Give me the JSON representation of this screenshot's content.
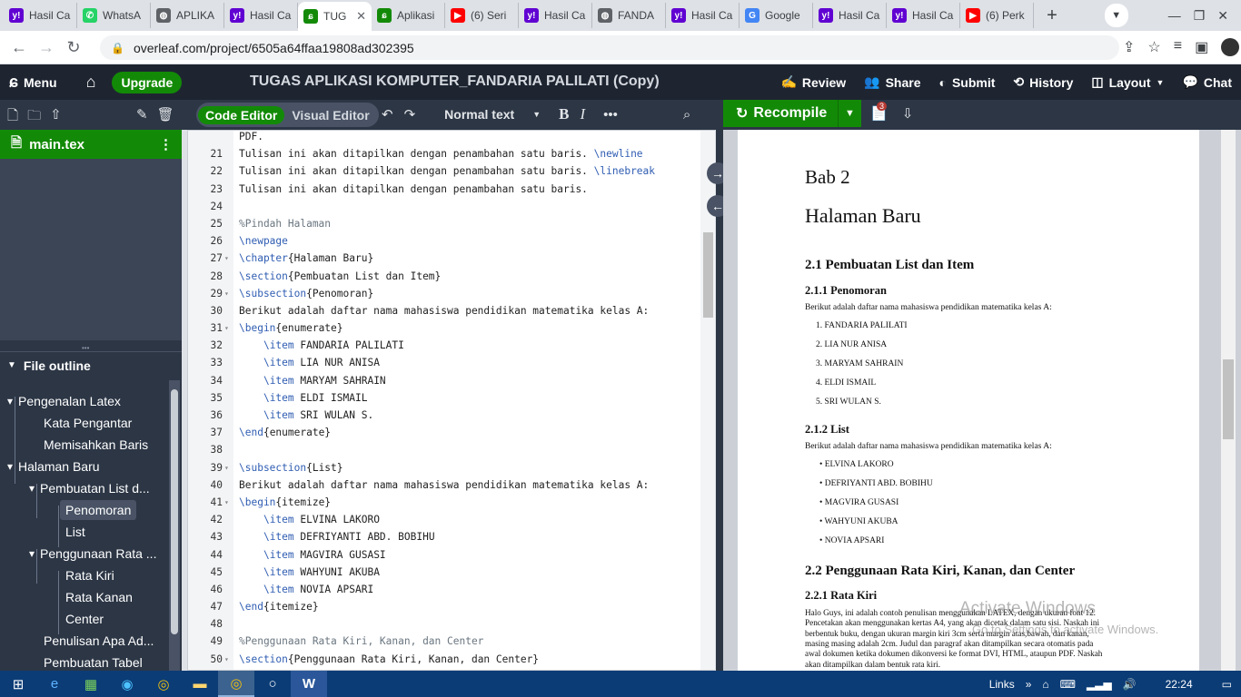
{
  "browser": {
    "tabs": [
      {
        "label": "Hasil Ca",
        "icon": "yahoo-icon",
        "color": "#6001d2"
      },
      {
        "label": "WhatsA",
        "icon": "whatsapp-icon",
        "color": "#25d366"
      },
      {
        "label": "APLIKA",
        "icon": "globe-icon",
        "color": "#5f6368"
      },
      {
        "label": "Hasil Ca",
        "icon": "yahoo-icon",
        "color": "#6001d2"
      },
      {
        "label": "TUG",
        "icon": "overleaf-icon",
        "color": "#138a07",
        "active": true
      },
      {
        "label": "Aplikasi",
        "icon": "overleaf-icon",
        "color": "#138a07"
      },
      {
        "label": "(6) Seri",
        "icon": "youtube-icon",
        "color": "#ff0000"
      },
      {
        "label": "Hasil Ca",
        "icon": "yahoo-icon",
        "color": "#6001d2"
      },
      {
        "label": "FANDA",
        "icon": "globe-icon",
        "color": "#5f6368"
      },
      {
        "label": "Hasil Ca",
        "icon": "yahoo-icon",
        "color": "#6001d2"
      },
      {
        "label": "Google",
        "icon": "google-translate-icon",
        "color": "#4285f4"
      },
      {
        "label": "Hasil Ca",
        "icon": "yahoo-icon",
        "color": "#6001d2"
      },
      {
        "label": "Hasil Ca",
        "icon": "yahoo-icon",
        "color": "#6001d2"
      },
      {
        "label": "(6) Perk",
        "icon": "youtube-icon",
        "color": "#ff0000"
      }
    ],
    "url": "overleaf.com/project/6505a64ffaa19808ad302395"
  },
  "topbar": {
    "menu": "Menu",
    "upgrade": "Upgrade",
    "title": "TUGAS APLIKASI KOMPUTER_FANDARIA PALILATI (Copy)",
    "review": "Review",
    "share": "Share",
    "submit": "Submit",
    "history": "History",
    "layout": "Layout",
    "chat": "Chat"
  },
  "toolbar": {
    "code_editor": "Code Editor",
    "visual_editor": "Visual Editor",
    "style": "Normal text",
    "recompile": "Recompile",
    "logs_badge": "3"
  },
  "sidebar": {
    "file": "main.tex",
    "outline_title": "File outline",
    "outline": [
      {
        "label": "Pengenalan Latex"
      },
      {
        "label": "Kata Pengantar"
      },
      {
        "label": "Memisahkan Baris"
      },
      {
        "label": "Halaman Baru"
      },
      {
        "label": "Pembuatan List d..."
      },
      {
        "label": "Penomoran"
      },
      {
        "label": "List"
      },
      {
        "label": "Penggunaan Rata ..."
      },
      {
        "label": "Rata Kiri"
      },
      {
        "label": "Rata Kanan"
      },
      {
        "label": "Center"
      },
      {
        "label": "Penulisan Apa Ad..."
      },
      {
        "label": "Pembuatan Tabel"
      }
    ]
  },
  "editor": {
    "lines": [
      {
        "n": "",
        "t": "PDF."
      },
      {
        "n": "21",
        "t": "Tulisan ini akan ditapilkan dengan penambahan satu baris. \\newline"
      },
      {
        "n": "22",
        "t": "Tulisan ini akan ditapilkan dengan penambahan satu baris. \\linebreak"
      },
      {
        "n": "23",
        "t": "Tulisan ini akan ditapilkan dengan penambahan satu baris."
      },
      {
        "n": "24",
        "t": ""
      },
      {
        "n": "25",
        "t": "%Pindah Halaman"
      },
      {
        "n": "26",
        "t": "\\newpage"
      },
      {
        "n": "27",
        "t": "\\chapter{Halaman Baru}"
      },
      {
        "n": "28",
        "t": "\\section{Pembuatan List dan Item}"
      },
      {
        "n": "29",
        "t": "\\subsection{Penomoran}"
      },
      {
        "n": "30",
        "t": "Berikut adalah daftar nama mahasiswa pendidikan matematika kelas A:"
      },
      {
        "n": "31",
        "t": "\\begin{enumerate}"
      },
      {
        "n": "32",
        "t": "    \\item FANDARIA PALILATI"
      },
      {
        "n": "33",
        "t": "    \\item LIA NUR ANISA"
      },
      {
        "n": "34",
        "t": "    \\item MARYAM SAHRAIN"
      },
      {
        "n": "35",
        "t": "    \\item ELDI ISMAIL"
      },
      {
        "n": "36",
        "t": "    \\item SRI WULAN S."
      },
      {
        "n": "37",
        "t": "\\end{enumerate}"
      },
      {
        "n": "38",
        "t": ""
      },
      {
        "n": "39",
        "t": "\\subsection{List}"
      },
      {
        "n": "40",
        "t": "Berikut adalah daftar nama mahasiswa pendidikan matematika kelas A:"
      },
      {
        "n": "41",
        "t": "\\begin{itemize}"
      },
      {
        "n": "42",
        "t": "    \\item ELVINA LAKORO"
      },
      {
        "n": "43",
        "t": "    \\item DEFRIYANTI ABD. BOBIHU"
      },
      {
        "n": "44",
        "t": "    \\item MAGVIRA GUSASI"
      },
      {
        "n": "45",
        "t": "    \\item WAHYUNI AKUBA"
      },
      {
        "n": "46",
        "t": "    \\item NOVIA APSARI"
      },
      {
        "n": "47",
        "t": "\\end{itemize}"
      },
      {
        "n": "48",
        "t": ""
      },
      {
        "n": "49",
        "t": "%Penggunaan Rata Kiri, Kanan, dan Center"
      },
      {
        "n": "50",
        "t": "\\section{Penggunaan Rata Kiri, Kanan, dan Center}"
      }
    ]
  },
  "pdf": {
    "bab": "Bab 2",
    "chapter": "Halaman Baru",
    "sec1": "2.1    Pembuatan List dan Item",
    "sub1": "2.1.1    Penomoran",
    "intro1": "Berikut adalah daftar nama mahasiswa pendidikan matematika kelas A:",
    "enum": [
      "1.  FANDARIA PALILATI",
      "2.  LIA NUR ANISA",
      "3.  MARYAM SAHRAIN",
      "4.  ELDI ISMAIL",
      "5.  SRI WULAN S."
    ],
    "sub2": "2.1.2    List",
    "intro2": "Berikut adalah daftar nama mahasiswa pendidikan matematika kelas A:",
    "items": [
      "ELVINA LAKORO",
      "DEFRIYANTI ABD. BOBIHU",
      "MAGVIRA GUSASI",
      "WAHYUNI AKUBA",
      "NOVIA APSARI"
    ],
    "sec2": "2.2    Penggunaan Rata Kiri, Kanan, dan Center",
    "sub3": "2.2.1    Rata Kiri",
    "para": [
      "Halo Guys, ini adalah contoh penulisan menggunakan LATEX, dengan ukuran font 12.",
      "Pencetakan akan menggunakan kertas A4, yang akan dicetak dalam satu sisi. Naskah ini",
      "berbentuk buku, dengan ukuran margin kiri 3cm serta margin atas,bawah, dan kanan,",
      "masing masing adalah 2cm. Judul dan paragraf akan ditampilkan secara otomatis pada",
      "awal dokumen ketika dokumen dikonversi ke format DVI, HTML, ataupun PDF. Naskah",
      "akan ditampilkan dalam bentuk rata kiri."
    ]
  },
  "windows": {
    "watermark": "Activate Windows",
    "watermark2": "Go to Settings to activate Windows.",
    "links": "Links",
    "time": "22:24"
  }
}
